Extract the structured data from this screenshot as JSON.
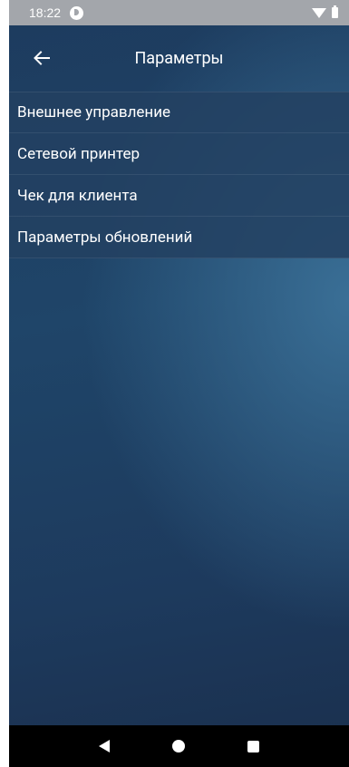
{
  "status_bar": {
    "time": "18:22",
    "app_icon": "circle-p-icon",
    "right_icons": [
      "wifi-icon",
      "battery-icon"
    ]
  },
  "app_bar": {
    "back_icon": "arrow-left-icon",
    "title": "Параметры"
  },
  "menu": {
    "items": [
      {
        "label": "Внешнее управление"
      },
      {
        "label": "Сетевой принтер"
      },
      {
        "label": "Чек для клиента"
      },
      {
        "label": "Параметры обновлений"
      }
    ]
  },
  "nav_bar": {
    "icons": [
      "nav-back-icon",
      "nav-home-icon",
      "nav-recents-icon"
    ]
  },
  "colors": {
    "background": "#1f4569",
    "status_bar": "#a3a6ab",
    "menu_item": "#234162",
    "nav_bar": "#000000"
  }
}
